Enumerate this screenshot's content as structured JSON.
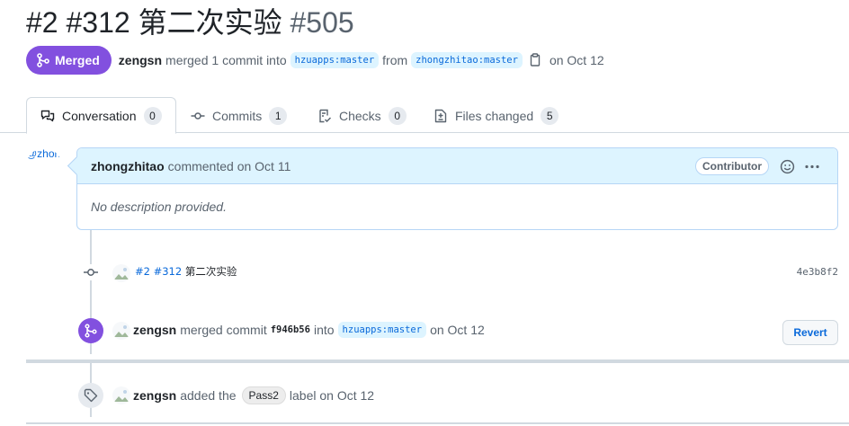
{
  "header": {
    "title": "#2 #312 第二次实验",
    "number": "#505"
  },
  "meta": {
    "state": "Merged",
    "author": "zengsn",
    "action": "merged 1 commit into",
    "base_branch": "hzuapps:master",
    "from_word": "from",
    "head_branch": "zhongzhitao:master",
    "date": "on Oct 12"
  },
  "tabs": [
    {
      "label": "Conversation",
      "count": "0",
      "icon": "comment-discussion-icon"
    },
    {
      "label": "Commits",
      "count": "1",
      "icon": "git-commit-icon"
    },
    {
      "label": "Checks",
      "count": "0",
      "icon": "checklist-icon"
    },
    {
      "label": "Files changed",
      "count": "5",
      "icon": "file-diff-icon"
    }
  ],
  "comment": {
    "avatar_alt": "@zhongzhitao",
    "author": "zhongzhitao",
    "action": "commented on Oct 11",
    "role": "Contributor",
    "body": "No description provided."
  },
  "commit": {
    "message_ref": "#2 #312",
    "message_text": "第二次实验",
    "sha": "4e3b8f2"
  },
  "merge_event": {
    "author": "zengsn",
    "action": "merged commit",
    "commit": "f946b56",
    "into_word": "into",
    "branch": "hzuapps:master",
    "date": "on Oct 12",
    "revert_label": "Revert"
  },
  "label_event": {
    "author": "zengsn",
    "action": "added the",
    "label": "Pass2",
    "suffix": "label on Oct 12"
  },
  "colors": {
    "merged": "#8250df",
    "link": "#0969da",
    "branch_bg": "#ddf4ff",
    "border": "#d1d9e0"
  }
}
